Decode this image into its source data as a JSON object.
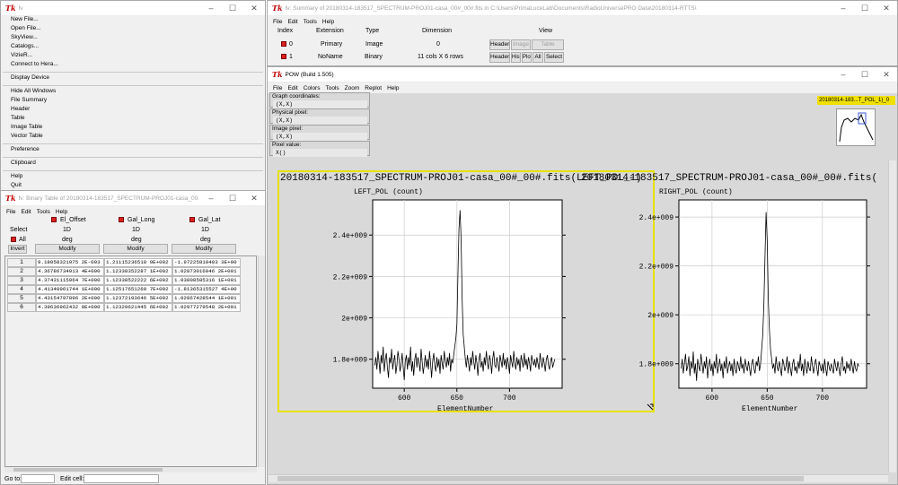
{
  "main_win": {
    "title": "fv",
    "menu": [
      "New File...",
      "Open File...",
      "SkyView...",
      "Catalogs...",
      "VizieR...",
      "Connect to Hera...",
      "Display Device",
      "Hide All Windows",
      "File Summary",
      "Header",
      "Table",
      "Image Table",
      "Vector Table",
      "Preference",
      "Clipboard",
      "Help",
      "Quit"
    ]
  },
  "summary_win": {
    "title": "fv: Summary of 20180314-183517_SPECTRUM-PROJ01-casa_00#_00#.fits in C:\\Users\\PrimaLuceLab\\Documents\\RadioUniversePRO Data\\20180314-RTTS\\",
    "menu": [
      "File",
      "Edit",
      "Tools",
      "Help"
    ],
    "headers": {
      "index": "Index",
      "extension": "Extension",
      "type": "Type",
      "dimension": "Dimension",
      "view": "View"
    },
    "rows": [
      {
        "index": "0",
        "extension": "Primary",
        "type": "Image",
        "dimension": "0"
      },
      {
        "index": "1",
        "extension": "NoName",
        "type": "Binary",
        "dimension": "11 cols X 6 rows"
      }
    ],
    "buttons": {
      "header": "Header",
      "image": "Image",
      "table": "Table",
      "hist": "Hist",
      "plot": "Plot",
      "all": "All",
      "select": "Select"
    }
  },
  "binary_win": {
    "title": "fv: Binary Table of 20180314-183517_SPECTRUM-PROJ01-casa_00#_00#.fits[1]",
    "menu": [
      "File",
      "Edit",
      "Tools",
      "Help"
    ],
    "select_label": "Select",
    "all_label": "All",
    "invert_label": "Invert",
    "modify_label": "Modify",
    "columns": [
      {
        "name": "El_Offset",
        "dim": "1D",
        "unit": "deg"
      },
      {
        "name": "Gal_Long",
        "dim": "1D",
        "unit": "deg"
      },
      {
        "name": "Gal_Lat",
        "dim": "1D",
        "unit": "deg"
      }
    ],
    "rows": [
      [
        "1",
        "9.18058321975 2E-003",
        "1.21115236518 9E+002",
        "-1.97225810403 3E+00"
      ],
      [
        "2",
        "4.36786734913 4E+000",
        "1.12338352287 1E+002",
        "1.02873016046 2E+001"
      ],
      [
        "3",
        "4.37431115964 7E+000",
        "1.12338522222 6E+002",
        "1.03008585316 1E+001"
      ],
      [
        "4",
        "4.41340961744 1E+000",
        "1.12517651260 7E+002",
        "-1.81365315527 4E+00"
      ],
      [
        "5",
        "4.43154797896 2E+000",
        "1.12372193646 5E+002",
        "1.02867428544 1E+001"
      ],
      [
        "6",
        "4.39636962432 8E+000",
        "1.12329621445 6E+002",
        "1.02977279548 2E+001"
      ]
    ],
    "goto_label": "Go to:",
    "editcell_label": "Edit cell:"
  },
  "pow_win": {
    "title": "POW (Build 1.505)",
    "menu": [
      "File",
      "Edit",
      "Colors",
      "Tools",
      "Zoom",
      "Replot",
      "Help"
    ],
    "info": [
      {
        "label": "Graph coordinates:",
        "value": "(X,X)"
      },
      {
        "label": "Physical pixel:",
        "value": "(X,X)"
      },
      {
        "label": "Image pixel:",
        "value": "(X,X)"
      },
      {
        "label": "Pixel value:",
        "value": "X()"
      }
    ],
    "thumb_label": "20180314-183...T_POL_1)_0",
    "graph_title_left": "20180314-183517_SPECTRUM-PROJ01-casa_00#_00#.fits(LEFT_POL_1)",
    "graph_title_right": "20180314-183517_SPECTRUM-PROJ01-casa_00#_00#.fits(",
    "colors": {
      "highlight": "#e8e000",
      "thumb_bg": "#f0e000"
    }
  },
  "chart_data": [
    {
      "type": "line",
      "title": "LEFT_POL (count)",
      "xlabel": "ElementNumber",
      "xlim": [
        570,
        750
      ],
      "ylim": [
        1660000000.0,
        2570000000.0
      ],
      "xticks": [
        600,
        650,
        700
      ],
      "yticks": [
        {
          "v": 1800000000.0,
          "label": "1.8e+009"
        },
        {
          "v": 2000000000.0,
          "label": "2e+009"
        },
        {
          "v": 2200000000.0,
          "label": "2.2e+009"
        },
        {
          "v": 2400000000.0,
          "label": "2.4e+009"
        }
      ],
      "series": [
        {
          "x0": 572,
          "dx": 1,
          "values": [
            1770000000.0,
            1810000000.0,
            1750000000.0,
            1840000000.0,
            1790000000.0,
            1730000000.0,
            1820000000.0,
            1780000000.0,
            1860000000.0,
            1740000000.0,
            1800000000.0,
            1830000000.0,
            1760000000.0,
            1710000000.0,
            1810000000.0,
            1780000000.0,
            1850000000.0,
            1750000000.0,
            1790000000.0,
            1820000000.0,
            1730000000.0,
            1770000000.0,
            1840000000.0,
            1800000000.0,
            1740000000.0,
            1780000000.0,
            1830000000.0,
            1760000000.0,
            1700000000.0,
            1790000000.0,
            1820000000.0,
            1750000000.0,
            1810000000.0,
            1770000000.0,
            1860000000.0,
            1740000000.0,
            1790000000.0,
            1720000000.0,
            1800000000.0,
            1830000000.0,
            1760000000.0,
            1810000000.0,
            1780000000.0,
            1740000000.0,
            1850000000.0,
            1790000000.0,
            1730000000.0,
            1770000000.0,
            1820000000.0,
            1760000000.0,
            1800000000.0,
            1750000000.0,
            1840000000.0,
            1780000000.0,
            1710000000.0,
            1790000000.0,
            1830000000.0,
            1770000000.0,
            1740000000.0,
            1810000000.0,
            1760000000.0,
            1800000000.0,
            1730000000.0,
            1820000000.0,
            1780000000.0,
            1750000000.0,
            1840000000.0,
            1790000000.0,
            1760000000.0,
            1810000000.0,
            1770000000.0,
            1830000000.0,
            1740000000.0,
            1800000000.0,
            1780000000.0,
            1820000000.0,
            1860000000.0,
            1900000000.0,
            1970000000.0,
            2200000000.0,
            2430000000.0,
            2520000000.0,
            2380000000.0,
            2100000000.0,
            1920000000.0,
            1860000000.0,
            1800000000.0,
            1760000000.0,
            1820000000.0,
            1780000000.0,
            1740000000.0,
            1810000000.0,
            1770000000.0,
            1840000000.0,
            1790000000.0,
            1750000000.0,
            1820000000.0,
            1780000000.0,
            1720000000.0,
            1800000000.0,
            1830000000.0,
            1760000000.0,
            1790000000.0,
            1740000000.0,
            1810000000.0,
            1770000000.0,
            1840000000.0,
            1780000000.0,
            1750000000.0,
            1820000000.0,
            1790000000.0,
            1730000000.0,
            1800000000.0,
            1840000000.0,
            1770000000.0,
            1760000000.0,
            1810000000.0,
            1780000000.0,
            1740000000.0,
            1820000000.0,
            1790000000.0,
            1760000000.0,
            1830000000.0,
            1770000000.0,
            1800000000.0,
            1750000000.0,
            1810000000.0,
            1780000000.0,
            1730000000.0,
            1820000000.0,
            1790000000.0,
            1760000000.0,
            1840000000.0,
            1780000000.0,
            1750000000.0,
            1810000000.0,
            1770000000.0,
            1800000000.0,
            1740000000.0,
            1820000000.0,
            1790000000.0,
            1760000000.0,
            1830000000.0,
            1770000000.0,
            1800000000.0,
            1750000000.0,
            1810000000.0,
            1780000000.0,
            1740000000.0,
            1820000000.0,
            1790000000.0,
            1770000000.0,
            1800000000.0,
            1760000000.0,
            1810000000.0,
            1780000000.0,
            1750000000.0,
            1830000000.0,
            1790000000.0,
            1760000000.0,
            1810000000.0,
            1780000000.0,
            1740000000.0,
            1800000000.0,
            1820000000.0,
            1770000000.0,
            1750000000.0,
            1790000000.0,
            1810000000.0,
            1760000000.0,
            1780000000.0,
            1800000000.0
          ]
        }
      ]
    },
    {
      "type": "line",
      "title": "RIGHT_POL (count)",
      "xlabel": "ElementNumber",
      "xlim": [
        570,
        740
      ],
      "ylim": [
        1700000000.0,
        2470000000.0
      ],
      "xticks": [
        600,
        650,
        700
      ],
      "yticks": [
        {
          "v": 1800000000.0,
          "label": "1.8e+009"
        },
        {
          "v": 2000000000.0,
          "label": "2e+009"
        },
        {
          "v": 2200000000.0,
          "label": "2.2e+009"
        },
        {
          "v": 2400000000.0,
          "label": "2.4e+009"
        }
      ],
      "series": [
        {
          "x0": 572,
          "dx": 1,
          "values": [
            1780000000.0,
            1820000000.0,
            1760000000.0,
            1800000000.0,
            1840000000.0,
            1770000000.0,
            1790000000.0,
            1830000000.0,
            1750000000.0,
            1810000000.0,
            1780000000.0,
            1850000000.0,
            1760000000.0,
            1800000000.0,
            1730000000.0,
            1820000000.0,
            1790000000.0,
            1770000000.0,
            1840000000.0,
            1800000000.0,
            1760000000.0,
            1810000000.0,
            1780000000.0,
            1830000000.0,
            1740000000.0,
            1790000000.0,
            1820000000.0,
            1770000000.0,
            1800000000.0,
            1750000000.0,
            1810000000.0,
            1780000000.0,
            1840000000.0,
            1760000000.0,
            1790000000.0,
            1820000000.0,
            1770000000.0,
            1800000000.0,
            1740000000.0,
            1810000000.0,
            1780000000.0,
            1830000000.0,
            1760000000.0,
            1790000000.0,
            1810000000.0,
            1770000000.0,
            1800000000.0,
            1750000000.0,
            1820000000.0,
            1780000000.0,
            1760000000.0,
            1810000000.0,
            1790000000.0,
            1770000000.0,
            1830000000.0,
            1780000000.0,
            1800000000.0,
            1760000000.0,
            1820000000.0,
            1790000000.0,
            1770000000.0,
            1810000000.0,
            1780000000.0,
            1750000000.0,
            1800000000.0,
            1820000000.0,
            1780000000.0,
            1760000000.0,
            1810000000.0,
            1790000000.0,
            1830000000.0,
            1770000000.0,
            1800000000.0,
            1860000000.0,
            1920000000.0,
            2050000000.0,
            2240000000.0,
            2420000000.0,
            2300000000.0,
            2060000000.0,
            1940000000.0,
            1860000000.0,
            1820000000.0,
            1780000000.0,
            1800000000.0,
            1760000000.0,
            1830000000.0,
            1790000000.0,
            1770000000.0,
            1810000000.0,
            1780000000.0,
            1750000000.0,
            1820000000.0,
            1800000000.0,
            1770000000.0,
            1790000000.0,
            1830000000.0,
            1760000000.0,
            1810000000.0,
            1780000000.0,
            1750000000.0,
            1800000000.0,
            1820000000.0,
            1770000000.0,
            1790000000.0,
            1760000000.0,
            1810000000.0,
            1780000000.0,
            1840000000.0,
            1770000000.0,
            1800000000.0,
            1750000000.0,
            1820000000.0,
            1790000000.0,
            1760000000.0,
            1810000000.0,
            1780000000.0,
            1770000000.0,
            1830000000.0,
            1790000000.0,
            1760000000.0,
            1800000000.0,
            1820000000.0,
            1780000000.0,
            1750000000.0,
            1810000000.0,
            1790000000.0,
            1770000000.0,
            1800000000.0,
            1760000000.0,
            1820000000.0,
            1780000000.0,
            1750000000.0,
            1810000000.0,
            1790000000.0,
            1770000000.0,
            1800000000.0,
            1780000000.0,
            1760000000.0,
            1820000000.0,
            1790000000.0,
            1770000000.0,
            1810000000.0,
            1780000000.0,
            1750000000.0,
            1800000000.0,
            1830000000.0,
            1770000000.0,
            1790000000.0,
            1760000000.0,
            1810000000.0,
            1780000000.0,
            1800000000.0,
            1770000000.0,
            1820000000.0,
            1790000000.0,
            1760000000.0,
            1810000000.0,
            1780000000.0,
            1770000000.0,
            1800000000.0,
            1790000000.0
          ]
        }
      ]
    }
  ]
}
